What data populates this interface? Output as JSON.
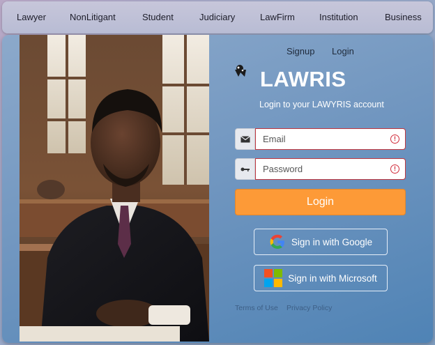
{
  "nav": {
    "items": [
      "Lawyer",
      "NonLitigant",
      "Student",
      "Judiciary",
      "LawFirm",
      "Institution",
      "Business"
    ]
  },
  "auth": {
    "signup": "Signup",
    "login": "Login"
  },
  "brand": {
    "name": "LAWRIS",
    "subtitle": "Login to your LAWYRIS account"
  },
  "form": {
    "email_placeholder": "Email",
    "password_placeholder": "Password",
    "login_button": "Login"
  },
  "oauth": {
    "google": "Sign in with Google",
    "microsoft": "Sign in with Microsoft"
  },
  "footer": {
    "terms": "Terms of Use",
    "privacy": "Privacy Policy"
  },
  "colors": {
    "accent": "#fd9a37",
    "error": "#d12b3a",
    "card": "#6f95bf"
  }
}
